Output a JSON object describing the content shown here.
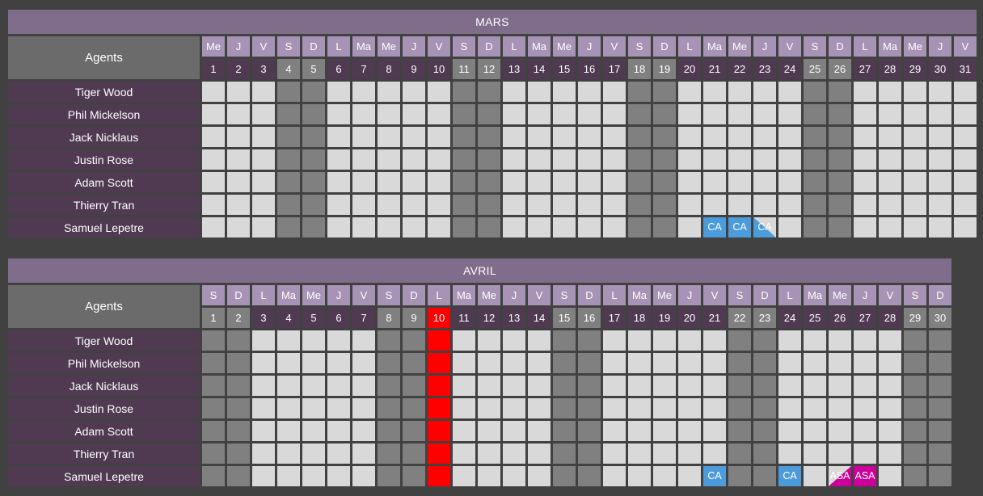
{
  "colors": {
    "background": "#414141",
    "month_title_bg": "#806D8C",
    "agents_header_bg": "#6B6B6B",
    "agent_name_bg": "#4F3A51",
    "dayofweek_bg": "#A793B5",
    "daynum_bg": "#4F3A51",
    "weekend_bg": "#808080",
    "holiday_bg": "#FF0000",
    "slot_bg": "#D9D9D9",
    "ca_color": "#4C9BDB",
    "asa_color": "#CC0099"
  },
  "agents_header_label": "Agents",
  "agents": [
    "Tiger Wood",
    "Phil Mickelson",
    "Jack Nicklaus",
    "Justin Rose",
    "Adam Scott",
    "Thierry Tran",
    "Samuel Lepetre"
  ],
  "months": [
    {
      "name": "MARS",
      "days": [
        {
          "num": "1",
          "dow": "Me",
          "weekend": false,
          "holiday": false
        },
        {
          "num": "2",
          "dow": "J",
          "weekend": false,
          "holiday": false
        },
        {
          "num": "3",
          "dow": "V",
          "weekend": false,
          "holiday": false
        },
        {
          "num": "4",
          "dow": "S",
          "weekend": true,
          "holiday": false
        },
        {
          "num": "5",
          "dow": "D",
          "weekend": true,
          "holiday": false
        },
        {
          "num": "6",
          "dow": "L",
          "weekend": false,
          "holiday": false
        },
        {
          "num": "7",
          "dow": "Ma",
          "weekend": false,
          "holiday": false
        },
        {
          "num": "8",
          "dow": "Me",
          "weekend": false,
          "holiday": false
        },
        {
          "num": "9",
          "dow": "J",
          "weekend": false,
          "holiday": false
        },
        {
          "num": "10",
          "dow": "V",
          "weekend": false,
          "holiday": false
        },
        {
          "num": "11",
          "dow": "S",
          "weekend": true,
          "holiday": false
        },
        {
          "num": "12",
          "dow": "D",
          "weekend": true,
          "holiday": false
        },
        {
          "num": "13",
          "dow": "L",
          "weekend": false,
          "holiday": false
        },
        {
          "num": "14",
          "dow": "Ma",
          "weekend": false,
          "holiday": false
        },
        {
          "num": "15",
          "dow": "Me",
          "weekend": false,
          "holiday": false
        },
        {
          "num": "16",
          "dow": "J",
          "weekend": false,
          "holiday": false
        },
        {
          "num": "17",
          "dow": "V",
          "weekend": false,
          "holiday": false
        },
        {
          "num": "18",
          "dow": "S",
          "weekend": true,
          "holiday": false
        },
        {
          "num": "19",
          "dow": "D",
          "weekend": true,
          "holiday": false
        },
        {
          "num": "20",
          "dow": "L",
          "weekend": false,
          "holiday": false
        },
        {
          "num": "21",
          "dow": "Ma",
          "weekend": false,
          "holiday": false
        },
        {
          "num": "22",
          "dow": "Me",
          "weekend": false,
          "holiday": false
        },
        {
          "num": "23",
          "dow": "J",
          "weekend": false,
          "holiday": false
        },
        {
          "num": "24",
          "dow": "V",
          "weekend": false,
          "holiday": false
        },
        {
          "num": "25",
          "dow": "S",
          "weekend": true,
          "holiday": false
        },
        {
          "num": "26",
          "dow": "D",
          "weekend": true,
          "holiday": false
        },
        {
          "num": "27",
          "dow": "L",
          "weekend": false,
          "holiday": false
        },
        {
          "num": "28",
          "dow": "Ma",
          "weekend": false,
          "holiday": false
        },
        {
          "num": "29",
          "dow": "Me",
          "weekend": false,
          "holiday": false
        },
        {
          "num": "30",
          "dow": "J",
          "weekend": false,
          "holiday": false
        },
        {
          "num": "31",
          "dow": "V",
          "weekend": false,
          "holiday": false
        }
      ],
      "absences": [
        {
          "agent": "Samuel Lepetre",
          "day": "21",
          "code": "CA",
          "half": false
        },
        {
          "agent": "Samuel Lepetre",
          "day": "22",
          "code": "CA",
          "half": false
        },
        {
          "agent": "Samuel Lepetre",
          "day": "23",
          "code": "CA",
          "half": true
        }
      ]
    },
    {
      "name": "AVRIL",
      "days": [
        {
          "num": "1",
          "dow": "S",
          "weekend": true,
          "holiday": false
        },
        {
          "num": "2",
          "dow": "D",
          "weekend": true,
          "holiday": false
        },
        {
          "num": "3",
          "dow": "L",
          "weekend": false,
          "holiday": false
        },
        {
          "num": "4",
          "dow": "Ma",
          "weekend": false,
          "holiday": false
        },
        {
          "num": "5",
          "dow": "Me",
          "weekend": false,
          "holiday": false
        },
        {
          "num": "6",
          "dow": "J",
          "weekend": false,
          "holiday": false
        },
        {
          "num": "7",
          "dow": "V",
          "weekend": false,
          "holiday": false
        },
        {
          "num": "8",
          "dow": "S",
          "weekend": true,
          "holiday": false
        },
        {
          "num": "9",
          "dow": "D",
          "weekend": true,
          "holiday": false
        },
        {
          "num": "10",
          "dow": "L",
          "weekend": false,
          "holiday": true
        },
        {
          "num": "11",
          "dow": "Ma",
          "weekend": false,
          "holiday": false
        },
        {
          "num": "12",
          "dow": "Me",
          "weekend": false,
          "holiday": false
        },
        {
          "num": "13",
          "dow": "J",
          "weekend": false,
          "holiday": false
        },
        {
          "num": "14",
          "dow": "V",
          "weekend": false,
          "holiday": false
        },
        {
          "num": "15",
          "dow": "S",
          "weekend": true,
          "holiday": false
        },
        {
          "num": "16",
          "dow": "D",
          "weekend": true,
          "holiday": false
        },
        {
          "num": "17",
          "dow": "L",
          "weekend": false,
          "holiday": false
        },
        {
          "num": "18",
          "dow": "Ma",
          "weekend": false,
          "holiday": false
        },
        {
          "num": "19",
          "dow": "Me",
          "weekend": false,
          "holiday": false
        },
        {
          "num": "20",
          "dow": "J",
          "weekend": false,
          "holiday": false
        },
        {
          "num": "21",
          "dow": "V",
          "weekend": false,
          "holiday": false
        },
        {
          "num": "22",
          "dow": "S",
          "weekend": true,
          "holiday": false
        },
        {
          "num": "23",
          "dow": "D",
          "weekend": true,
          "holiday": false
        },
        {
          "num": "24",
          "dow": "L",
          "weekend": false,
          "holiday": false
        },
        {
          "num": "25",
          "dow": "Ma",
          "weekend": false,
          "holiday": false
        },
        {
          "num": "26",
          "dow": "Me",
          "weekend": false,
          "holiday": false
        },
        {
          "num": "27",
          "dow": "J",
          "weekend": false,
          "holiday": false
        },
        {
          "num": "28",
          "dow": "V",
          "weekend": false,
          "holiday": false
        },
        {
          "num": "29",
          "dow": "S",
          "weekend": true,
          "holiday": false
        },
        {
          "num": "30",
          "dow": "D",
          "weekend": true,
          "holiday": false
        }
      ],
      "absences": [
        {
          "agent": "Samuel Lepetre",
          "day": "21",
          "code": "CA",
          "half": false
        },
        {
          "agent": "Samuel Lepetre",
          "day": "24",
          "code": "CA",
          "half": false
        },
        {
          "agent": "Samuel Lepetre",
          "day": "26",
          "code": "ASA",
          "half": true
        },
        {
          "agent": "Samuel Lepetre",
          "day": "27",
          "code": "ASA",
          "half": false
        }
      ]
    }
  ]
}
